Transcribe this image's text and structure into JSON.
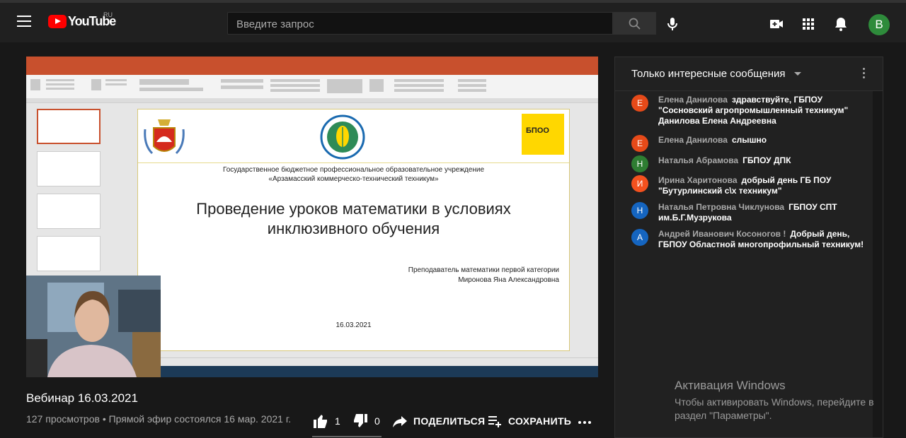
{
  "header": {
    "logo_text": "YouTube",
    "logo_region": "RU",
    "search_placeholder": "Введите запрос",
    "avatar_letter": "B"
  },
  "slide": {
    "org_line1": "Государственное бюджетное профессиональное образовательное учреждение",
    "org_line2": "«Арзамасский коммерческо-технический техникум»",
    "title_line1": "Проведение уроков математики в условиях",
    "title_line2": "инклюзивного обучения",
    "teacher_line1": "Преподаватель математики первой категории",
    "teacher_line2": "Миронова Яна Александровна",
    "date": "16.03.2021",
    "logo_badge": "БПОО"
  },
  "video": {
    "title": "Вебинар 16.03.2021",
    "meta": "127 просмотров • Прямой эфир состоялся 16 мар. 2021 г.",
    "likes": "1",
    "dislikes": "0",
    "share_label": "ПОДЕЛИТЬСЯ",
    "save_label": "СОХРАНИТЬ"
  },
  "chat": {
    "header_title": "Только интересные сообщения",
    "messages": [
      {
        "avatar": "Е",
        "color": "#e64a19",
        "author": "Елена Данилова",
        "text": "здравствуйте, ГБПОУ \"Сосновский агропромышленный техникум\" Данилова Елена Андреевна"
      },
      {
        "avatar": "Е",
        "color": "#e64a19",
        "author": "Елена Данилова",
        "text": "слышно"
      },
      {
        "avatar": "Н",
        "color": "#2e7d32",
        "author": "Наталья Абрамова",
        "text": "ГБПОУ ДПК"
      },
      {
        "avatar": "И",
        "color": "#f4511e",
        "author": "Ирина Харитонова",
        "text": "добрый день ГБ ПОУ \"Бутурлинский с\\х техникум\""
      },
      {
        "avatar": "Н",
        "color": "#1565c0",
        "author": "Наталья Петровна Чиклунова",
        "text": "ГБПОУ СПТ им.Б.Г.Музрукова"
      },
      {
        "avatar": "А",
        "color": "#1565c0",
        "author": "Андрей Иванович Косоногов !",
        "text": "Добрый день, ГБПОУ Областной многопрофильный техникум!"
      }
    ]
  },
  "windows_activation": {
    "title": "Активация Windows",
    "text": "Чтобы активировать Windows, перейдите в раздел \"Параметры\"."
  }
}
